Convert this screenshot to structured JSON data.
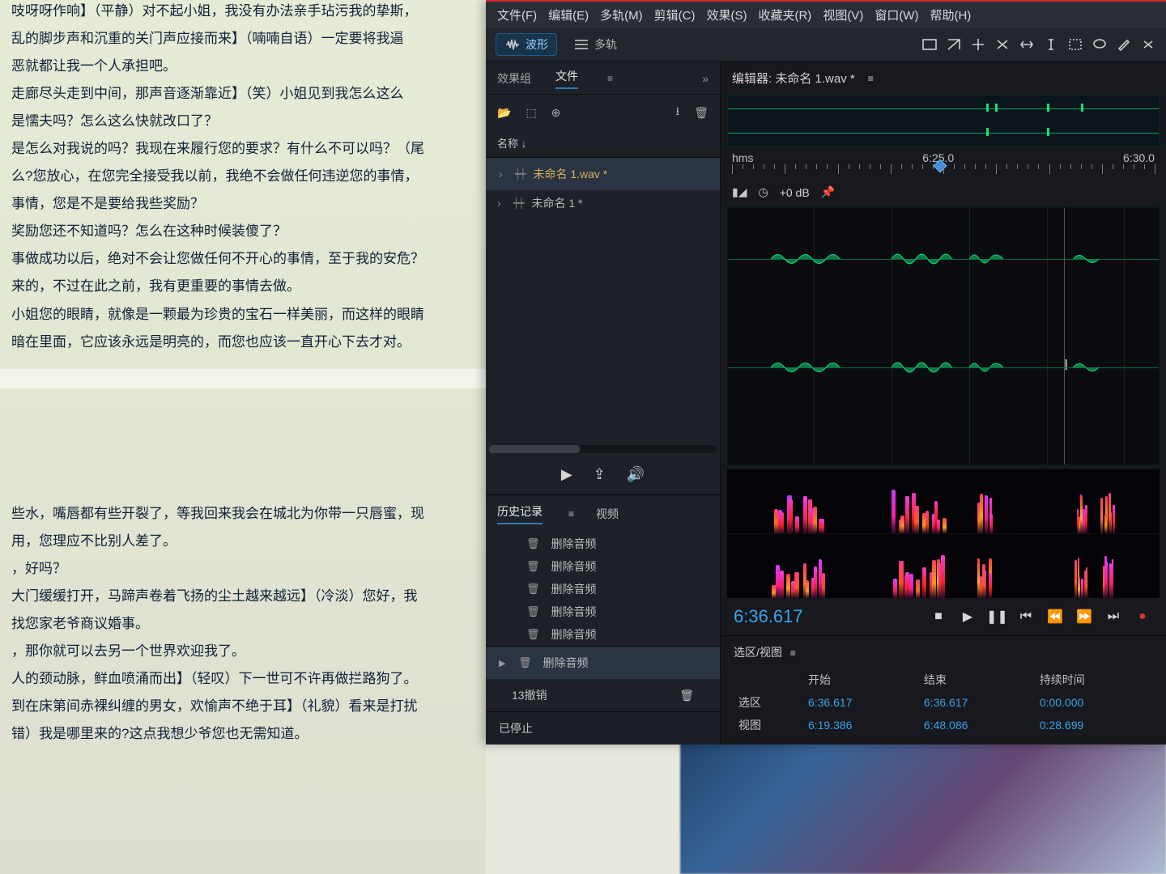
{
  "doc": {
    "lines": [
      "吱呀呀作响】（平静）对不起小姐，我没有办法亲手玷污我的挚斯，",
      "",
      "乱的脚步声和沉重的关门声应接而来】（喃喃自语）一定要将我逼",
      "恶就都让我一个人承担吧。",
      "",
      "走廊尽头走到中间，那声音逐渐靠近】（笑）小姐见到我怎么这么",
      "是懦夫吗？怎么这么快就改口了？",
      "是怎么对我说的吗？我现在来履行您的要求？有什么不可以吗？（尾",
      "",
      "么?您放心，在您完全接受我以前，我绝不会做任何违逆您的事情，",
      "事情，您是不是要给我些奖励？",
      "奖励您还不知道吗？怎么在这种时候装傻了？",
      "事做成功以后，绝对不会让您做任何不开心的事情，至于我的安危？",
      "来的，不过在此之前，我有更重要的事情去做。",
      "小姐您的眼睛，就像是一颗最为珍贵的宝石一样美丽，而这样的眼睛",
      "暗在里面，它应该永远是明亮的，而您也应该一直开心下去才对。"
    ],
    "lines2": [
      "些水，嘴唇都有些开裂了，等我回来我会在城北为你带一只唇蜜，现",
      "用，您理应不比别人差了。",
      "，好吗？",
      "",
      "大门缓缓打开，马蹄声卷着飞扬的尘土越来越远】（冷淡）您好，我",
      "找您家老爷商议婚事。",
      "，那你就可以去另一个世界欢迎我了。",
      "人的颈动脉，鲜血喷涌而出】（轻叹）下一世可不许再做拦路狗了。",
      "到在床第间赤裸纠缠的男女，欢愉声不绝于耳】（礼貌）看来是打扰",
      "错）我是哪里来的?这点我想少爷您也无需知道。"
    ]
  },
  "menu": [
    "文件(F)",
    "编辑(E)",
    "多轨(M)",
    "剪辑(C)",
    "效果(S)",
    "收藏夹(R)",
    "视图(V)",
    "窗口(W)",
    "帮助(H)"
  ],
  "toolbar": {
    "wave": "波形",
    "multi": "多轨"
  },
  "panel": {
    "fx": "效果组",
    "file": "文件",
    "name_hdr": "名称 ↓",
    "items": [
      {
        "label": "未命名 1.wav *",
        "sel": true
      },
      {
        "label": "未命名 1 *",
        "sel": false
      }
    ]
  },
  "transport_icons": [
    "▶",
    "⇪",
    "🔊"
  ],
  "history": {
    "title": "历史记录",
    "video": "视频",
    "items": [
      "删除音频",
      "删除音频",
      "删除音频",
      "删除音频",
      "删除音频",
      "删除音频"
    ],
    "undo": "13撤销"
  },
  "status": "已停止",
  "editor": {
    "title": "编辑器: 未命名 1.wav *",
    "hms": "hms",
    "t1": "6:25.0",
    "t2": "6:30.0",
    "db": "+0 dB",
    "time": "6:36.617"
  },
  "selview": {
    "title": "选区/视图",
    "cols": [
      "",
      "开始",
      "结束",
      "持续时间"
    ],
    "rows": [
      [
        "选区",
        "6:36.617",
        "6:36.617",
        "0:00.000"
      ],
      [
        "视图",
        "6:19.386",
        "6:48.086",
        "0:28.699"
      ]
    ]
  }
}
